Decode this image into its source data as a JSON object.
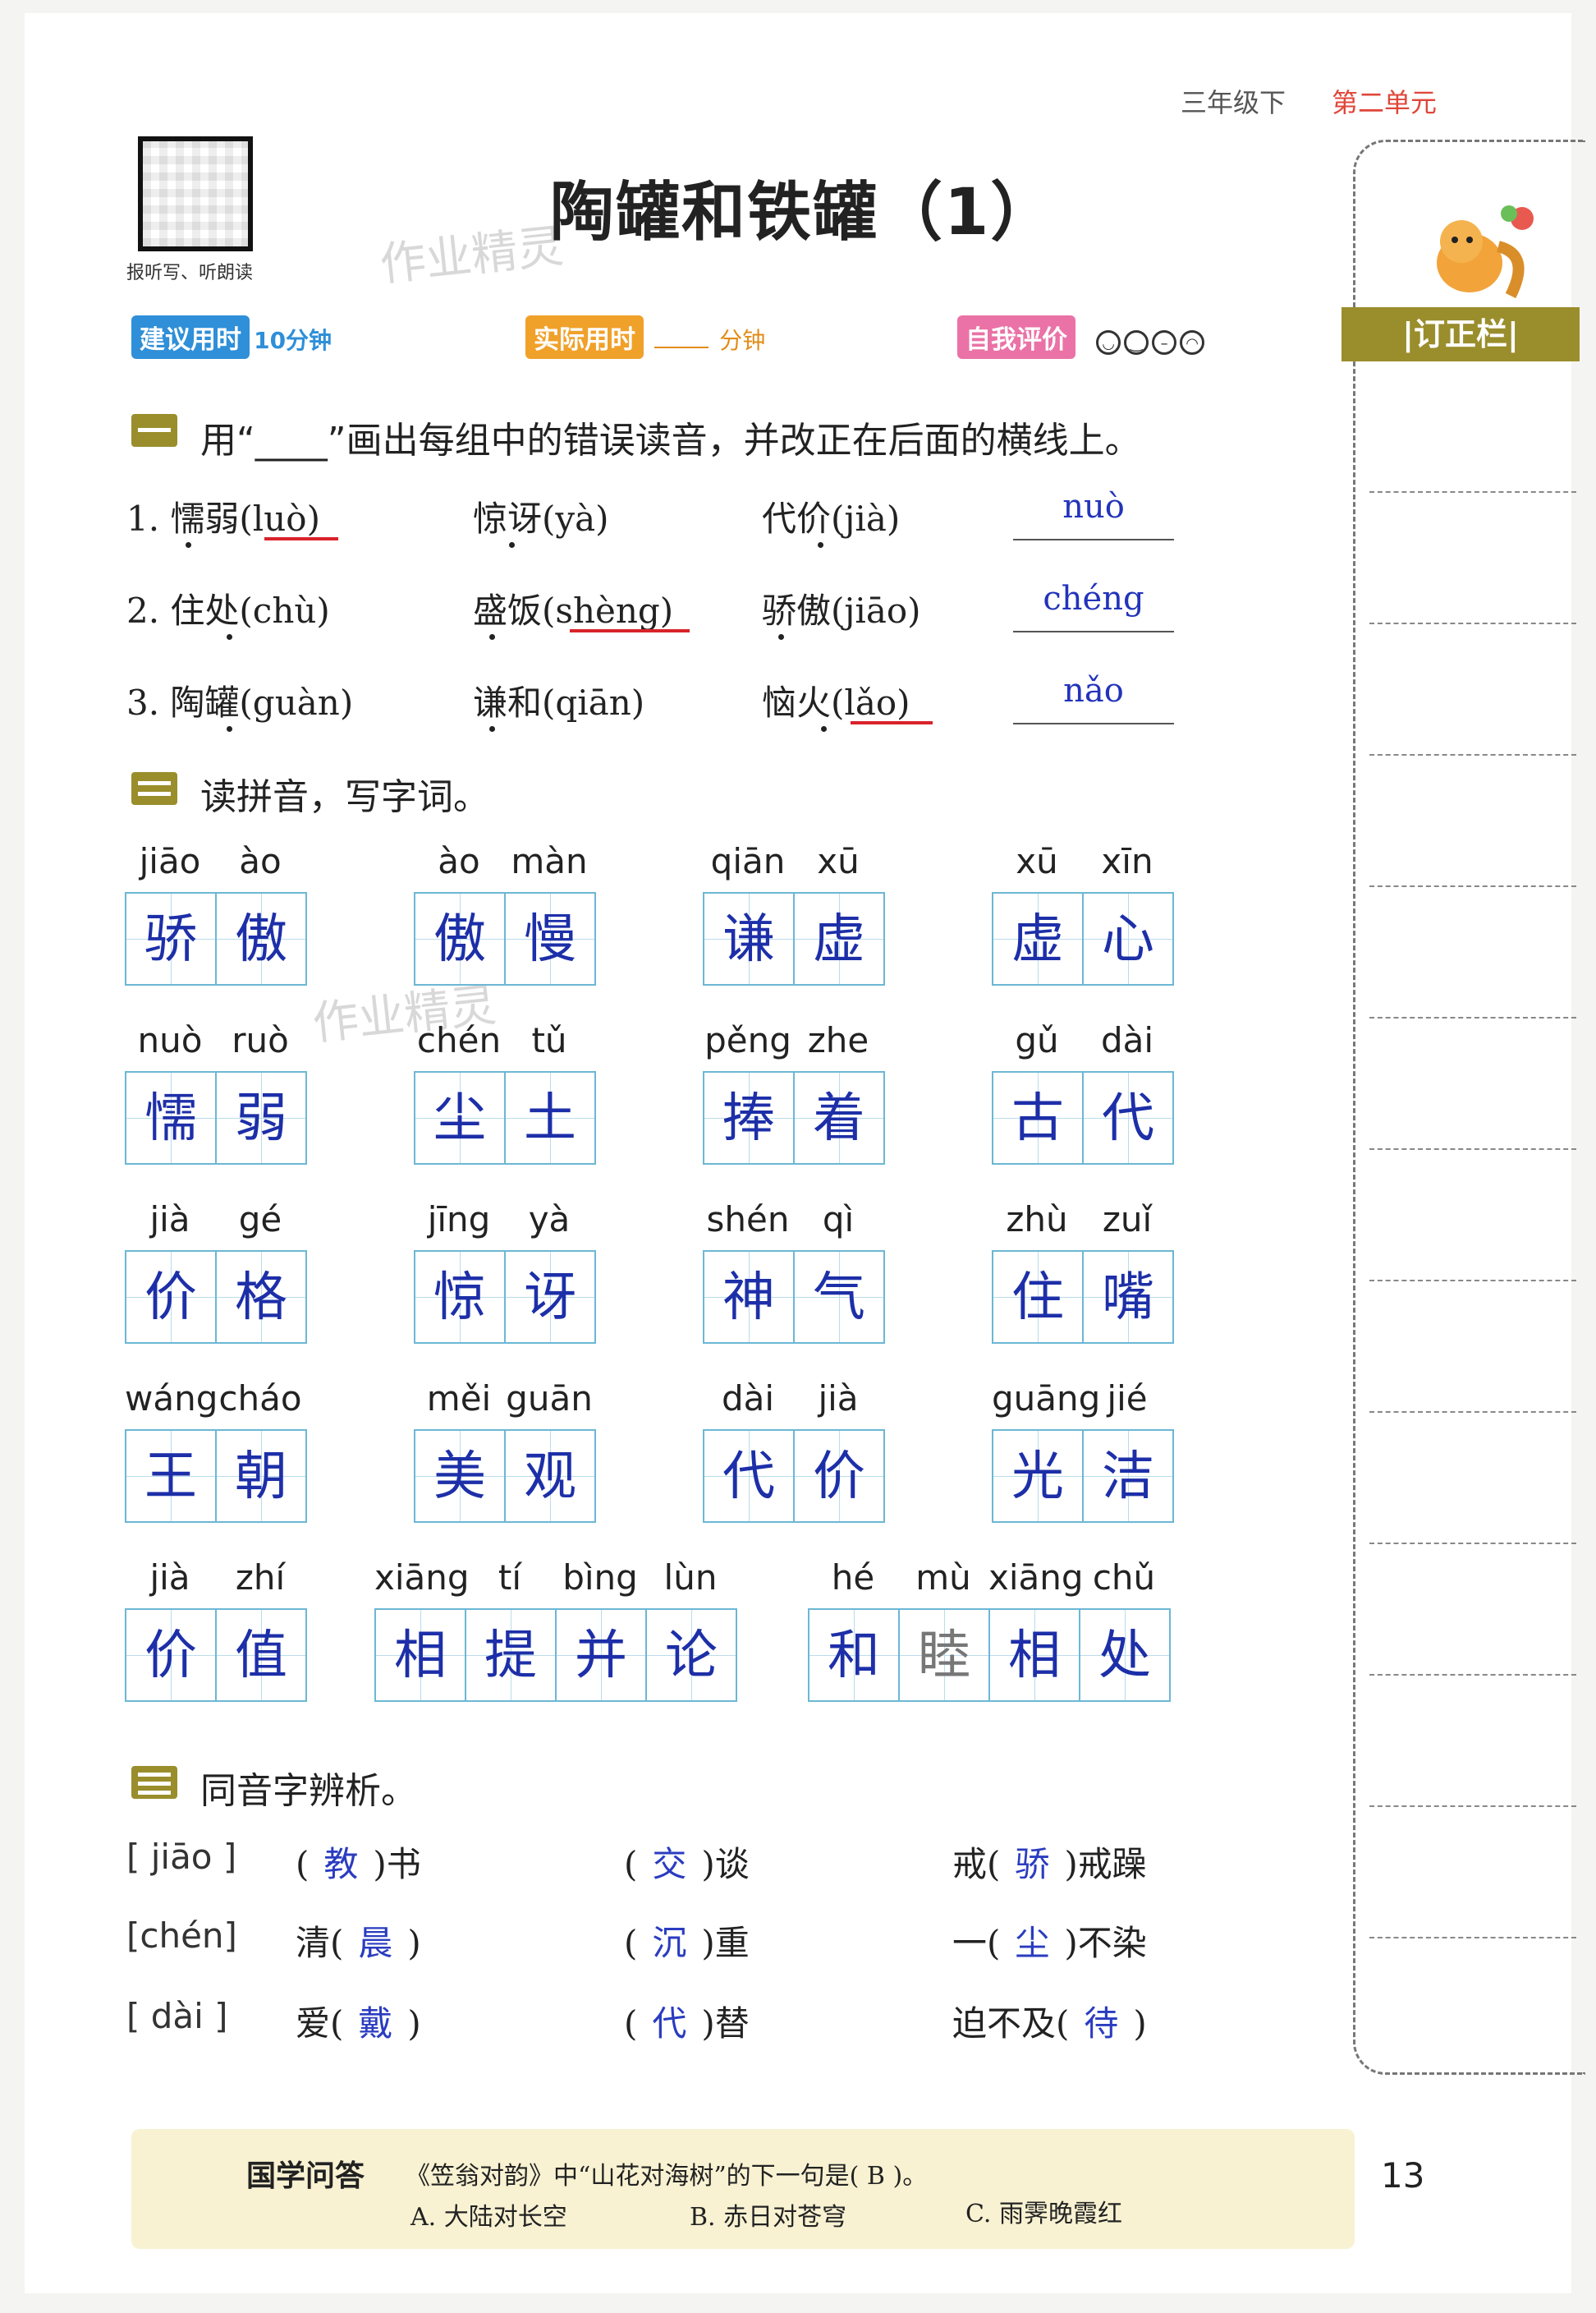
{
  "header": {
    "grade": "三年级下",
    "unit": "第二单元",
    "title": "陶罐和铁罐（1）",
    "qr_label": "报听写、听朗读",
    "watermark": "作业精灵"
  },
  "meta": {
    "suggest_label": "建议用时",
    "suggest_value": "10分钟",
    "actual_label": "实际用时",
    "actual_unit": "分钟",
    "self_label": "自我评价"
  },
  "sidebar": {
    "title": "|订正栏|"
  },
  "section1": {
    "title": "用“____”画出每组中的错误读音，并改正在后面的横线上。",
    "rows": [
      {
        "items": [
          "1. 懦弱(luò)",
          "惊讶(yà)",
          "代价(jià)"
        ],
        "answer": "nuò"
      },
      {
        "items": [
          "2. 住处(chù)",
          "盛饭(shèng)",
          "骄傲(jiāo)"
        ],
        "answer": "chéng"
      },
      {
        "items": [
          "3. 陶罐(guàn)",
          "谦和(qiān)",
          "恼火(lǎo)"
        ],
        "answer": "nǎo"
      }
    ]
  },
  "section2": {
    "title": "读拼音，写字词。",
    "rows": [
      [
        {
          "py": [
            "jiāo",
            "ào"
          ],
          "ch": [
            "骄",
            "傲"
          ]
        },
        {
          "py": [
            "ào",
            "màn"
          ],
          "ch": [
            "傲",
            "慢"
          ]
        },
        {
          "py": [
            "qiān",
            "xū"
          ],
          "ch": [
            "谦",
            "虚"
          ]
        },
        {
          "py": [
            "xū",
            "xīn"
          ],
          "ch": [
            "虚",
            "心"
          ]
        }
      ],
      [
        {
          "py": [
            "nuò",
            "ruò"
          ],
          "ch": [
            "懦",
            "弱"
          ]
        },
        {
          "py": [
            "chén",
            "tǔ"
          ],
          "ch": [
            "尘",
            "土"
          ]
        },
        {
          "py": [
            "pěng",
            "zhe"
          ],
          "ch": [
            "捧",
            "着"
          ]
        },
        {
          "py": [
            "gǔ",
            "dài"
          ],
          "ch": [
            "古",
            "代"
          ]
        }
      ],
      [
        {
          "py": [
            "jià",
            "gé"
          ],
          "ch": [
            "价",
            "格"
          ]
        },
        {
          "py": [
            "jīng",
            "yà"
          ],
          "ch": [
            "惊",
            "讶"
          ]
        },
        {
          "py": [
            "shén",
            "qì"
          ],
          "ch": [
            "神",
            "气"
          ]
        },
        {
          "py": [
            "zhù",
            "zuǐ"
          ],
          "ch": [
            "住",
            "嘴"
          ]
        }
      ],
      [
        {
          "py": [
            "wáng",
            "cháo"
          ],
          "ch": [
            "王",
            "朝"
          ]
        },
        {
          "py": [
            "měi",
            "guān"
          ],
          "ch": [
            "美",
            "观"
          ]
        },
        {
          "py": [
            "dài",
            "jià"
          ],
          "ch": [
            "代",
            "价"
          ]
        },
        {
          "py": [
            "guāng",
            "jié"
          ],
          "ch": [
            "光",
            "洁"
          ]
        }
      ],
      [
        {
          "py": [
            "jià",
            "zhí"
          ],
          "ch": [
            "价",
            "值"
          ]
        },
        {
          "py": [
            "xiāng",
            "tí",
            "bìng",
            "lùn"
          ],
          "ch": [
            "相",
            "提",
            "并",
            "论"
          ]
        },
        {
          "py": [
            "hé",
            "mù",
            "xiāng",
            "chǔ"
          ],
          "ch": [
            "和",
            "睦",
            "相",
            "处"
          ]
        }
      ]
    ]
  },
  "section3": {
    "title": "同音字辨析。",
    "rows": [
      {
        "label": "[ jiāo ]",
        "items": [
          [
            "(",
            "教",
            ")书"
          ],
          [
            "(",
            "交",
            ")谈"
          ],
          [
            "戒(",
            "骄",
            ")戒躁"
          ]
        ]
      },
      {
        "label": "[chén]",
        "items": [
          [
            "清(",
            "晨",
            ")"
          ],
          [
            "(",
            "沉",
            ")重"
          ],
          [
            "一(",
            "尘",
            ")不染"
          ]
        ]
      },
      {
        "label": "[ dài ]",
        "items": [
          [
            "爱(",
            "戴",
            ")"
          ],
          [
            "(",
            "代",
            ")替"
          ],
          [
            "迫不及(",
            "待",
            ")"
          ]
        ]
      }
    ]
  },
  "bottom": {
    "title": "国学问答",
    "question": "《笠翁对韵》中“山花对海树”的下一句是( B )。",
    "options": [
      "A. 大陆对长空",
      "B. 赤日对苍穹",
      "C. 雨霁晚霞红"
    ]
  },
  "page_number": "13"
}
